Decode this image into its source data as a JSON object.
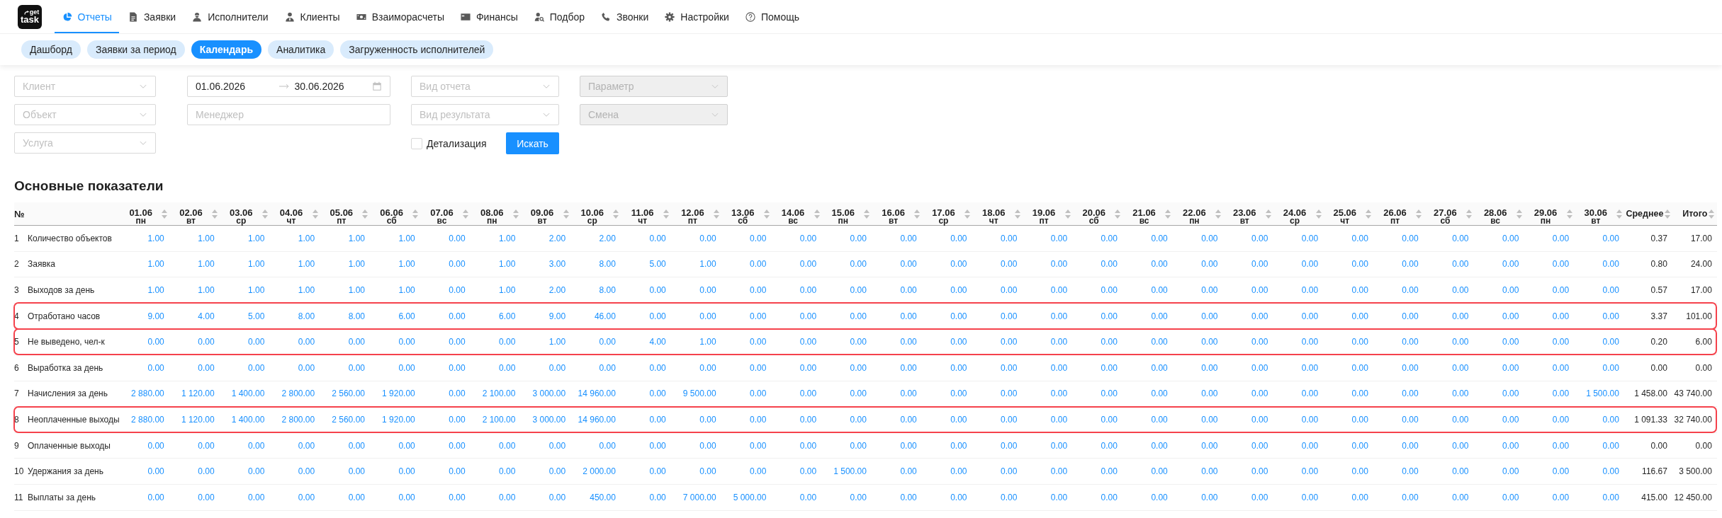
{
  "logo": {
    "top": "get",
    "bottom": "task"
  },
  "nav": [
    {
      "label": "Отчеты",
      "selected": true
    },
    {
      "label": "Заявки",
      "selected": false
    },
    {
      "label": "Исполнители",
      "selected": false
    },
    {
      "label": "Клиенты",
      "selected": false
    },
    {
      "label": "Взаиморасчеты",
      "selected": false
    },
    {
      "label": "Финансы",
      "selected": false
    },
    {
      "label": "Подбор",
      "selected": false
    },
    {
      "label": "Звонки",
      "selected": false
    },
    {
      "label": "Настройки",
      "selected": false
    },
    {
      "label": "Помощь",
      "selected": false
    }
  ],
  "subtabs": [
    {
      "label": "Дашборд",
      "selected": false
    },
    {
      "label": "Заявки за период",
      "selected": false
    },
    {
      "label": "Календарь",
      "selected": true
    },
    {
      "label": "Аналитика",
      "selected": false
    },
    {
      "label": "Загруженность исполнителей",
      "selected": false
    }
  ],
  "filters": {
    "columns": [
      [
        {
          "kind": "select",
          "placeholder": "Клиент",
          "disabled": false
        },
        {
          "kind": "select",
          "placeholder": "Объект",
          "disabled": false
        },
        {
          "kind": "select",
          "placeholder": "Услуга",
          "disabled": false
        }
      ],
      [
        {
          "kind": "date_range",
          "start": "01.06.2026",
          "end": "30.06.2026",
          "disabled": false
        },
        {
          "kind": "input",
          "placeholder": "Менеджер",
          "disabled": false
        }
      ],
      [
        {
          "kind": "select",
          "placeholder": "Вид отчета",
          "disabled": false
        },
        {
          "kind": "select",
          "placeholder": "Вид результата",
          "disabled": false
        },
        {
          "kind": "search",
          "checkbox": {
            "label": "Детализация",
            "checked": false
          },
          "button": "Искать"
        }
      ],
      [
        {
          "kind": "select",
          "placeholder": "Параметр",
          "disabled": true
        },
        {
          "kind": "select",
          "placeholder": "Смена",
          "disabled": true
        }
      ]
    ]
  },
  "section_title": "Основные показатели",
  "table": {
    "columns": [
      {
        "kind": "number",
        "label": "№"
      },
      {
        "kind": "day",
        "date": "01.06",
        "weekday": "пн"
      },
      {
        "kind": "day",
        "date": "02.06",
        "weekday": "вт"
      },
      {
        "kind": "day",
        "date": "03.06",
        "weekday": "ср"
      },
      {
        "kind": "day",
        "date": "04.06",
        "weekday": "чт"
      },
      {
        "kind": "day",
        "date": "05.06",
        "weekday": "пт"
      },
      {
        "kind": "day",
        "date": "06.06",
        "weekday": "сб"
      },
      {
        "kind": "day",
        "date": "07.06",
        "weekday": "вс"
      },
      {
        "kind": "day",
        "date": "08.06",
        "weekday": "пн"
      },
      {
        "kind": "day",
        "date": "09.06",
        "weekday": "вт"
      },
      {
        "kind": "day",
        "date": "10.06",
        "weekday": "ср"
      },
      {
        "kind": "day",
        "date": "11.06",
        "weekday": "чт"
      },
      {
        "kind": "day",
        "date": "12.06",
        "weekday": "пт"
      },
      {
        "kind": "day",
        "date": "13.06",
        "weekday": "сб"
      },
      {
        "kind": "day",
        "date": "14.06",
        "weekday": "вс"
      },
      {
        "kind": "day",
        "date": "15.06",
        "weekday": "пн"
      },
      {
        "kind": "day",
        "date": "16.06",
        "weekday": "вт"
      },
      {
        "kind": "day",
        "date": "17.06",
        "weekday": "ср"
      },
      {
        "kind": "day",
        "date": "18.06",
        "weekday": "чт"
      },
      {
        "kind": "day",
        "date": "19.06",
        "weekday": "пт"
      },
      {
        "kind": "day",
        "date": "20.06",
        "weekday": "сб"
      },
      {
        "kind": "day",
        "date": "21.06",
        "weekday": "вс"
      },
      {
        "kind": "day",
        "date": "22.06",
        "weekday": "пн"
      },
      {
        "kind": "day",
        "date": "23.06",
        "weekday": "вт"
      },
      {
        "kind": "day",
        "date": "24.06",
        "weekday": "ср"
      },
      {
        "kind": "day",
        "date": "25.06",
        "weekday": "чт"
      },
      {
        "kind": "day",
        "date": "26.06",
        "weekday": "пт"
      },
      {
        "kind": "day",
        "date": "27.06",
        "weekday": "сб"
      },
      {
        "kind": "day",
        "date": "28.06",
        "weekday": "вс"
      },
      {
        "kind": "day",
        "date": "29.06",
        "weekday": "пн"
      },
      {
        "kind": "day",
        "date": "30.06",
        "weekday": "вт"
      },
      {
        "kind": "summary",
        "label": "Среднее"
      },
      {
        "kind": "summary",
        "label": "Итого"
      }
    ],
    "rows": [
      {
        "number": "1",
        "name": "Количество объектов",
        "highlighted": false,
        "days": [
          "1.00",
          "1.00",
          "1.00",
          "1.00",
          "1.00",
          "1.00",
          "0.00",
          "1.00",
          "2.00",
          "2.00",
          "0.00",
          "0.00",
          "0.00",
          "0.00",
          "0.00",
          "0.00",
          "0.00",
          "0.00",
          "0.00",
          "0.00",
          "0.00",
          "0.00",
          "0.00",
          "0.00",
          "0.00",
          "0.00",
          "0.00",
          "0.00",
          "0.00",
          "0.00"
        ],
        "average": "0.37",
        "total": "17.00"
      },
      {
        "number": "2",
        "name": "Заявка",
        "highlighted": false,
        "days": [
          "1.00",
          "1.00",
          "1.00",
          "1.00",
          "1.00",
          "1.00",
          "0.00",
          "1.00",
          "3.00",
          "8.00",
          "5.00",
          "1.00",
          "0.00",
          "0.00",
          "0.00",
          "0.00",
          "0.00",
          "0.00",
          "0.00",
          "0.00",
          "0.00",
          "0.00",
          "0.00",
          "0.00",
          "0.00",
          "0.00",
          "0.00",
          "0.00",
          "0.00",
          "0.00"
        ],
        "average": "0.80",
        "total": "24.00"
      },
      {
        "number": "3",
        "name": "Выходов за день",
        "highlighted": false,
        "days": [
          "1.00",
          "1.00",
          "1.00",
          "1.00",
          "1.00",
          "1.00",
          "0.00",
          "1.00",
          "2.00",
          "8.00",
          "0.00",
          "0.00",
          "0.00",
          "0.00",
          "0.00",
          "0.00",
          "0.00",
          "0.00",
          "0.00",
          "0.00",
          "0.00",
          "0.00",
          "0.00",
          "0.00",
          "0.00",
          "0.00",
          "0.00",
          "0.00",
          "0.00",
          "0.00"
        ],
        "average": "0.57",
        "total": "17.00"
      },
      {
        "number": "4",
        "name": "Отработано часов",
        "highlighted": true,
        "days": [
          "9.00",
          "4.00",
          "5.00",
          "8.00",
          "8.00",
          "6.00",
          "0.00",
          "6.00",
          "9.00",
          "46.00",
          "0.00",
          "0.00",
          "0.00",
          "0.00",
          "0.00",
          "0.00",
          "0.00",
          "0.00",
          "0.00",
          "0.00",
          "0.00",
          "0.00",
          "0.00",
          "0.00",
          "0.00",
          "0.00",
          "0.00",
          "0.00",
          "0.00",
          "0.00"
        ],
        "average": "3.37",
        "total": "101.00"
      },
      {
        "number": "5",
        "name": "Не выведено, чел-к",
        "highlighted": true,
        "days": [
          "0.00",
          "0.00",
          "0.00",
          "0.00",
          "0.00",
          "0.00",
          "0.00",
          "0.00",
          "1.00",
          "0.00",
          "4.00",
          "1.00",
          "0.00",
          "0.00",
          "0.00",
          "0.00",
          "0.00",
          "0.00",
          "0.00",
          "0.00",
          "0.00",
          "0.00",
          "0.00",
          "0.00",
          "0.00",
          "0.00",
          "0.00",
          "0.00",
          "0.00",
          "0.00"
        ],
        "average": "0.20",
        "total": "6.00"
      },
      {
        "number": "6",
        "name": "Выработка за день",
        "highlighted": false,
        "days": [
          "0.00",
          "0.00",
          "0.00",
          "0.00",
          "0.00",
          "0.00",
          "0.00",
          "0.00",
          "0.00",
          "0.00",
          "0.00",
          "0.00",
          "0.00",
          "0.00",
          "0.00",
          "0.00",
          "0.00",
          "0.00",
          "0.00",
          "0.00",
          "0.00",
          "0.00",
          "0.00",
          "0.00",
          "0.00",
          "0.00",
          "0.00",
          "0.00",
          "0.00",
          "0.00"
        ],
        "average": "0.00",
        "total": "0.00"
      },
      {
        "number": "7",
        "name": "Начисления за день",
        "highlighted": false,
        "days": [
          "2 880.00",
          "1 120.00",
          "1 400.00",
          "2 800.00",
          "2 560.00",
          "1 920.00",
          "0.00",
          "2 100.00",
          "3 000.00",
          "14 960.00",
          "0.00",
          "9 500.00",
          "0.00",
          "0.00",
          "0.00",
          "0.00",
          "0.00",
          "0.00",
          "0.00",
          "0.00",
          "0.00",
          "0.00",
          "0.00",
          "0.00",
          "0.00",
          "0.00",
          "0.00",
          "0.00",
          "0.00",
          "1 500.00"
        ],
        "average": "1 458.00",
        "total": "43 740.00"
      },
      {
        "number": "8",
        "name": "Неоплаченные выходы",
        "highlighted": true,
        "days": [
          "2 880.00",
          "1 120.00",
          "1 400.00",
          "2 800.00",
          "2 560.00",
          "1 920.00",
          "0.00",
          "2 100.00",
          "3 000.00",
          "14 960.00",
          "0.00",
          "0.00",
          "0.00",
          "0.00",
          "0.00",
          "0.00",
          "0.00",
          "0.00",
          "0.00",
          "0.00",
          "0.00",
          "0.00",
          "0.00",
          "0.00",
          "0.00",
          "0.00",
          "0.00",
          "0.00",
          "0.00",
          "0.00"
        ],
        "average": "1 091.33",
        "total": "32 740.00"
      },
      {
        "number": "9",
        "name": "Оплаченные выходы",
        "highlighted": false,
        "days": [
          "0.00",
          "0.00",
          "0.00",
          "0.00",
          "0.00",
          "0.00",
          "0.00",
          "0.00",
          "0.00",
          "0.00",
          "0.00",
          "0.00",
          "0.00",
          "0.00",
          "0.00",
          "0.00",
          "0.00",
          "0.00",
          "0.00",
          "0.00",
          "0.00",
          "0.00",
          "0.00",
          "0.00",
          "0.00",
          "0.00",
          "0.00",
          "0.00",
          "0.00",
          "0.00"
        ],
        "average": "0.00",
        "total": "0.00"
      },
      {
        "number": "10",
        "name": "Удержания за день",
        "highlighted": false,
        "days": [
          "0.00",
          "0.00",
          "0.00",
          "0.00",
          "0.00",
          "0.00",
          "0.00",
          "0.00",
          "0.00",
          "2 000.00",
          "0.00",
          "0.00",
          "0.00",
          "0.00",
          "1 500.00",
          "0.00",
          "0.00",
          "0.00",
          "0.00",
          "0.00",
          "0.00",
          "0.00",
          "0.00",
          "0.00",
          "0.00",
          "0.00",
          "0.00",
          "0.00",
          "0.00",
          "0.00"
        ],
        "average": "116.67",
        "total": "3 500.00"
      },
      {
        "number": "11",
        "name": "Выплаты за день",
        "highlighted": false,
        "days": [
          "0.00",
          "0.00",
          "0.00",
          "0.00",
          "0.00",
          "0.00",
          "0.00",
          "0.00",
          "0.00",
          "450.00",
          "0.00",
          "7 000.00",
          "5 000.00",
          "0.00",
          "0.00",
          "0.00",
          "0.00",
          "0.00",
          "0.00",
          "0.00",
          "0.00",
          "0.00",
          "0.00",
          "0.00",
          "0.00",
          "0.00",
          "0.00",
          "0.00",
          "0.00",
          "0.00"
        ],
        "average": "415.00",
        "total": "12 450.00"
      }
    ]
  }
}
